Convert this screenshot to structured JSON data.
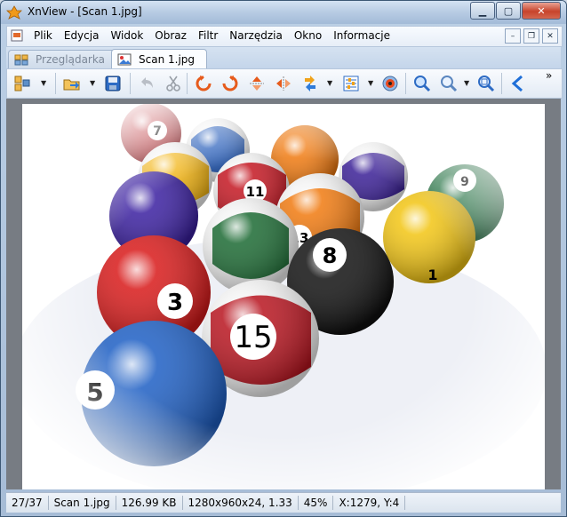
{
  "window": {
    "title": "XnView - [Scan 1.jpg]",
    "controls": {
      "minimize": "▁",
      "maximize": "▢",
      "close": "✕"
    }
  },
  "menu": {
    "items": [
      "Plik",
      "Edycja",
      "Widok",
      "Obraz",
      "Filtr",
      "Narzędzia",
      "Okno",
      "Informacje"
    ],
    "mdi_controls": {
      "minimize": "–",
      "restore": "❐",
      "close": "✕"
    }
  },
  "tabs": [
    {
      "label": "Przeglądarka",
      "active": false
    },
    {
      "label": "Scan 1.jpg",
      "active": true
    }
  ],
  "toolbar": {
    "buttons": [
      "browse-icon",
      "open-icon",
      "save-icon",
      "undo-icon",
      "cut-icon",
      "rotate-left-icon",
      "rotate-right-icon",
      "flip-vertical-icon",
      "flip-horizontal-icon",
      "auto-rotate-icon",
      "adjust-icon",
      "color-icon",
      "zoom-in-icon",
      "zoom-out-icon",
      "zoom-fit-icon",
      "previous-icon"
    ],
    "overflow": "»"
  },
  "image": {
    "balls": [
      "7",
      "11",
      "13",
      "8",
      "9",
      "3",
      "15",
      "5",
      "1"
    ]
  },
  "status": {
    "index": "27/37",
    "filename": "Scan 1.jpg",
    "size": "126.99 KB",
    "dimensions": "1280x960x24, 1.33",
    "zoom": "45%",
    "cursor": "X:1279, Y:4"
  },
  "colors": {
    "accent": "#3a6ea5",
    "title_gradient": "#b7cbe3",
    "close_button": "#c7432b"
  }
}
